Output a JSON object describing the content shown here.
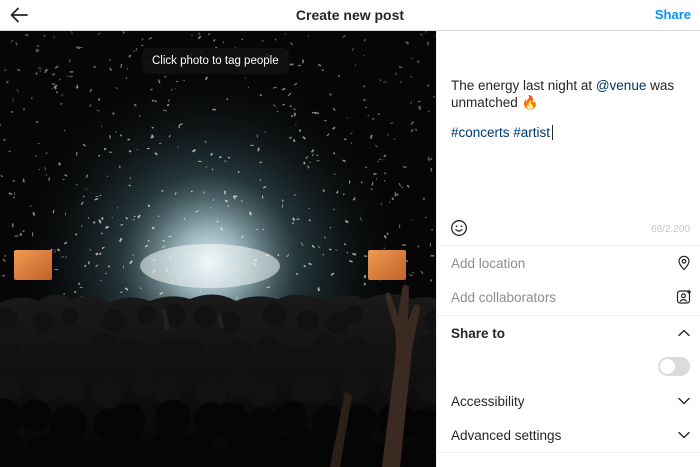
{
  "header": {
    "title": "Create new post",
    "share_label": "Share",
    "back_icon": "arrow-left-icon",
    "accent_color": "#0095f6"
  },
  "photo": {
    "tooltip": "Click photo to tag people",
    "description": "concert crowd with confetti and stage lights"
  },
  "caption": {
    "text_before": "The energy last night at ",
    "mention": "@venue",
    "text_after": " was unmatched 🔥",
    "hashtags": "#concerts #artist",
    "char_count": "68/2,200",
    "emoji_icon": "smiley-icon"
  },
  "options": {
    "location_placeholder": "Add location",
    "location_icon": "location-pin-icon",
    "collaborators_placeholder": "Add collaborators",
    "collaborators_icon": "add-person-icon",
    "share_to_label": "Share to",
    "share_to_expanded": true,
    "share_toggle_on": false,
    "accessibility_label": "Accessibility",
    "advanced_settings_label": "Advanced settings"
  }
}
